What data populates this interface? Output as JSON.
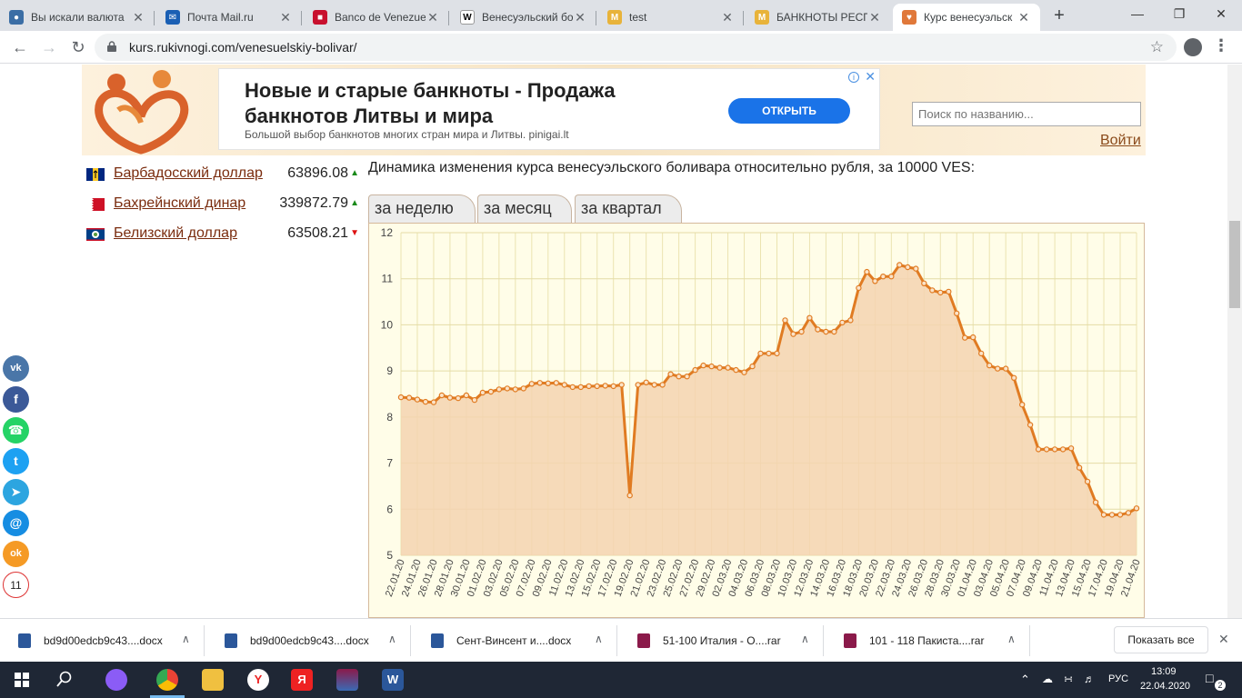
{
  "browser": {
    "tabs": [
      {
        "title": "Вы искали валюта",
        "color": "#3b6ea5",
        "glyph": "●"
      },
      {
        "title": "Почта Mail.ru",
        "color": "#1a5fb4",
        "glyph": "✉"
      },
      {
        "title": "Banco de Venezue",
        "color": "#c8102e",
        "glyph": "■"
      },
      {
        "title": "Венесуэльский бо",
        "color": "#ffffff",
        "glyph": "W"
      },
      {
        "title": "test",
        "color": "#e8b33a",
        "glyph": "M"
      },
      {
        "title": "БАНКНОТЫ РЕСПУ",
        "color": "#e8b33a",
        "glyph": "M"
      },
      {
        "title": "Курс венесуэльск",
        "color": "#e0783a",
        "glyph": "♥"
      }
    ],
    "new_tab": "+",
    "url": "kurs.rukivnogi.com/venesuelskiy-bolivar/"
  },
  "ad": {
    "title": "Новые и старые банкноты - Продажа банкнотов Литвы и мира",
    "subtitle": "Большой выбор банкнотов многих стран мира и Литвы. pinigai.lt",
    "button": "ОТКРЫТЬ"
  },
  "header": {
    "search_placeholder": "Поиск по названию...",
    "login": "Войти"
  },
  "currencies": [
    {
      "name": "Барбадосский доллар",
      "value": "63896.08",
      "dir": "up",
      "arrow": "▲"
    },
    {
      "name": "Бахрейнский динар",
      "value": "339872.79",
      "dir": "up",
      "arrow": "▲"
    },
    {
      "name": "Белизский доллар",
      "value": "63508.21",
      "dir": "down",
      "arrow": "▼"
    }
  ],
  "chart_title": "Динамика изменения курса венесуэльского боливара относительно рубля, за 10000 VES:",
  "chart_tabs": [
    "за неделю",
    "за месяц",
    "за квартал"
  ],
  "chart_data": {
    "type": "area",
    "ylim": [
      5,
      12
    ],
    "yticks": [
      5,
      6,
      7,
      8,
      9,
      10,
      11,
      12
    ],
    "grid": true,
    "line_color": "#e07b22",
    "fill_color": "#f5d3b0",
    "xlabels": [
      "22.01.20",
      "24.01.20",
      "26.01.20",
      "28.01.20",
      "30.01.20",
      "01.02.20",
      "03.02.20",
      "05.02.20",
      "07.02.20",
      "09.02.20",
      "11.02.20",
      "13.02.20",
      "15.02.20",
      "17.02.20",
      "19.02.20",
      "21.02.20",
      "23.02.20",
      "25.02.20",
      "27.02.20",
      "29.02.20",
      "02.03.20",
      "04.03.20",
      "06.03.20",
      "08.03.20",
      "10.03.20",
      "12.03.20",
      "14.03.20",
      "16.03.20",
      "18.03.20",
      "20.03.20",
      "22.03.20",
      "24.03.20",
      "26.03.20",
      "28.03.20",
      "30.03.20",
      "01.04.20",
      "03.04.20",
      "05.04.20",
      "07.04.20",
      "09.04.20",
      "11.04.20",
      "13.04.20",
      "15.04.20",
      "17.04.20",
      "19.04.20",
      "21.04.20"
    ],
    "values": [
      8.43,
      8.42,
      8.38,
      8.33,
      8.32,
      8.47,
      8.42,
      8.41,
      8.47,
      8.37,
      8.53,
      8.55,
      8.6,
      8.62,
      8.6,
      8.62,
      8.72,
      8.74,
      8.73,
      8.74,
      8.7,
      8.65,
      8.65,
      8.67,
      8.67,
      8.68,
      8.67,
      8.7,
      6.3,
      8.7,
      8.75,
      8.7,
      8.7,
      8.93,
      8.88,
      8.88,
      9.02,
      9.12,
      9.1,
      9.07,
      9.07,
      9.02,
      8.97,
      9.1,
      9.38,
      9.38,
      9.38,
      10.1,
      9.8,
      9.85,
      10.15,
      9.9,
      9.85,
      9.85,
      10.05,
      10.1,
      10.8,
      11.15,
      10.95,
      11.05,
      11.05,
      11.3,
      11.25,
      11.22,
      10.9,
      10.75,
      10.7,
      10.72,
      10.25,
      9.72,
      9.73,
      9.38,
      9.12,
      9.05,
      9.05,
      8.85,
      8.27,
      7.83,
      7.3,
      7.3,
      7.3,
      7.3,
      7.32,
      6.9,
      6.6,
      6.15,
      5.88,
      5.88,
      5.88,
      5.92,
      6.02
    ]
  },
  "social": [
    {
      "name": "vk",
      "color": "#4a76a8",
      "glyph": "vk"
    },
    {
      "name": "facebook",
      "color": "#3b5998",
      "glyph": "f"
    },
    {
      "name": "whatsapp",
      "color": "#25d366",
      "glyph": "☎"
    },
    {
      "name": "twitter",
      "color": "#1da1f2",
      "glyph": "t"
    },
    {
      "name": "telegram",
      "color": "#2ca5e0",
      "glyph": "➤"
    },
    {
      "name": "mail",
      "color": "#168de2",
      "glyph": "@"
    },
    {
      "name": "odnoklassniki",
      "color": "#f59a25",
      "glyph": "ok"
    }
  ],
  "share_count": "11",
  "downloads": [
    {
      "name": "bd9d00edcb9c43....docx",
      "color": "#2b579a"
    },
    {
      "name": "bd9d00edcb9c43....docx",
      "color": "#2b579a"
    },
    {
      "name": "Сент-Винсент и....docx",
      "color": "#2b579a"
    },
    {
      "name": "51-100 Италия - О....rar",
      "color": "#8b1a4a"
    },
    {
      "name": "101 - 118 Пакиста....rar",
      "color": "#8b1a4a"
    }
  ],
  "show_all": "Показать все",
  "taskbar": {
    "lang": "РУС",
    "time": "13:09",
    "date": "22.04.2020",
    "notifications": "2"
  }
}
